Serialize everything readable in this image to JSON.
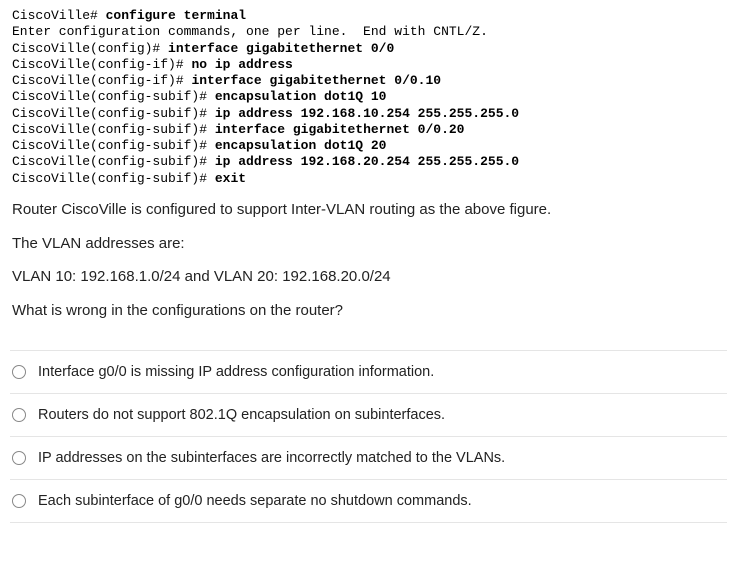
{
  "terminal": {
    "lines": [
      {
        "prompt": "CiscoVille# ",
        "cmd": "configure terminal"
      },
      {
        "plain": "Enter configuration commands, one per line.  End with CNTL/Z."
      },
      {
        "prompt": "CiscoVille(config)# ",
        "cmd": "interface gigabitethernet 0/0"
      },
      {
        "prompt": "CiscoVille(config-if)# ",
        "cmd": "no ip address"
      },
      {
        "prompt": "CiscoVille(config-if)# ",
        "cmd": "interface gigabitethernet 0/0.10"
      },
      {
        "prompt": "CiscoVille(config-subif)# ",
        "cmd": "encapsulation dot1Q 10"
      },
      {
        "prompt": "CiscoVille(config-subif)# ",
        "cmd": "ip address 192.168.10.254 255.255.255.0"
      },
      {
        "prompt": "CiscoVille(config-subif)# ",
        "cmd": "interface gigabitethernet 0/0.20"
      },
      {
        "prompt": "CiscoVille(config-subif)# ",
        "cmd": "encapsulation dot1Q 20"
      },
      {
        "prompt": "CiscoVille(config-subif)# ",
        "cmd": "ip address 192.168.20.254 255.255.255.0"
      },
      {
        "prompt": "CiscoVille(config-subif)# ",
        "cmd": "exit"
      }
    ]
  },
  "question": {
    "p1": "Router CiscoVille is configured to support Inter-VLAN routing as the above figure.",
    "p2": "The VLAN addresses are:",
    "p3": "VLAN 10: 192.168.1.0/24 and VLAN 20: 192.168.20.0/24",
    "p4": "What is wrong in the configurations on the router?"
  },
  "options": [
    {
      "label": "Interface g0/0 is missing IP address configuration information."
    },
    {
      "label": "Routers do not support 802.1Q encapsulation on subinterfaces."
    },
    {
      "label": "IP addresses on the subinterfaces are incorrectly matched to the VLANs."
    },
    {
      "label": "Each subinterface of g0/0 needs separate no shutdown commands."
    }
  ]
}
